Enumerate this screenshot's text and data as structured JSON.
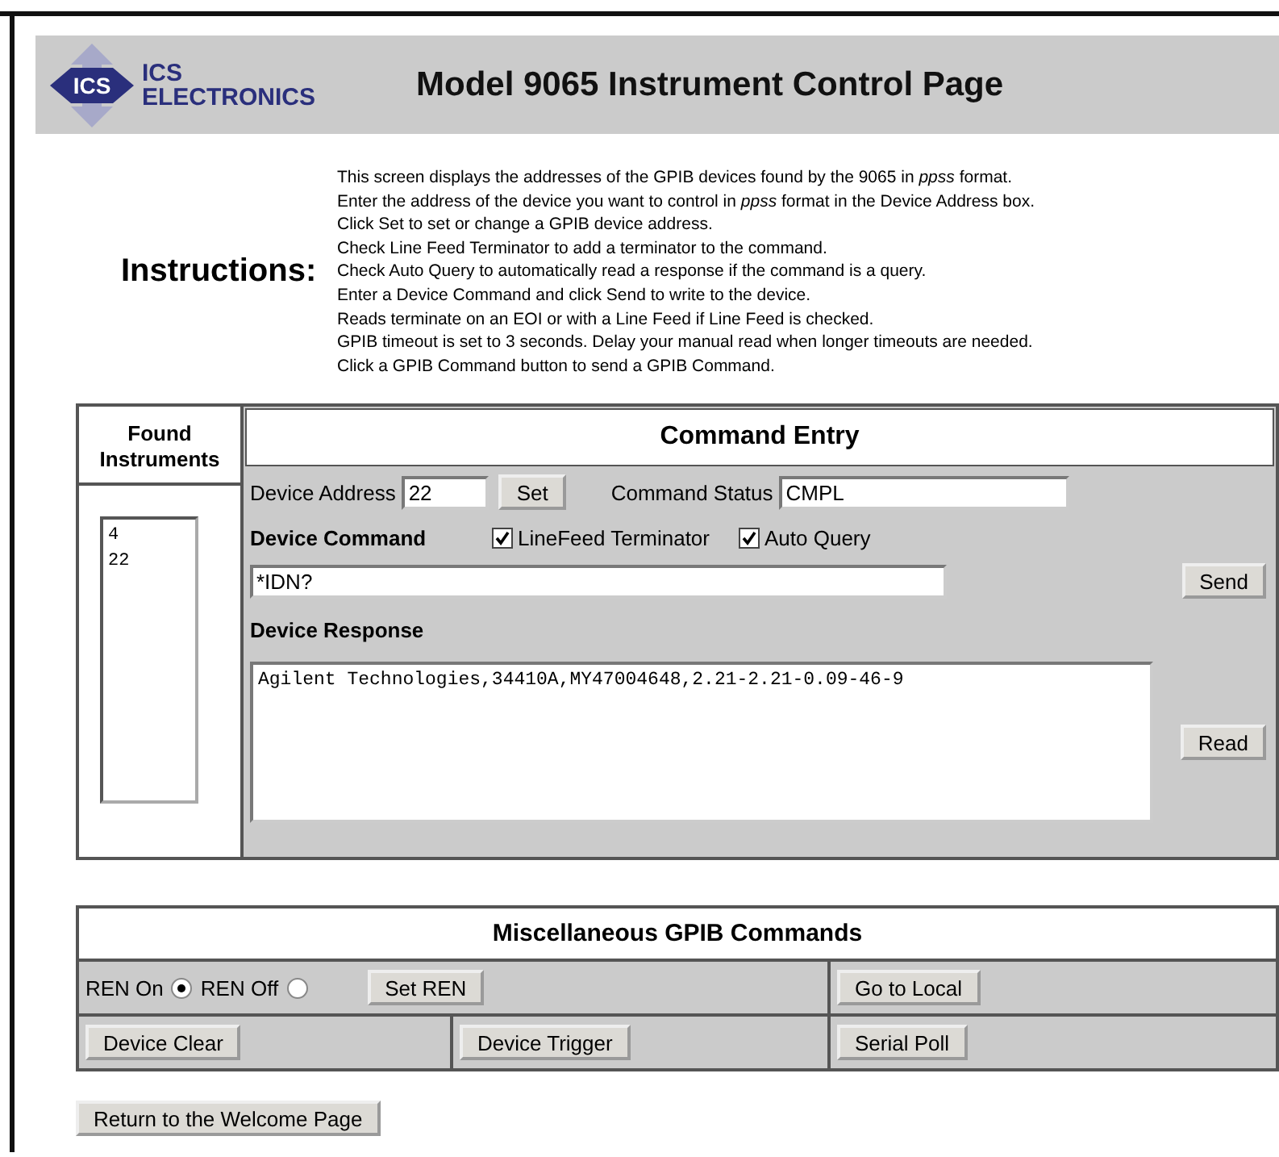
{
  "header": {
    "logo_badge": "ICS",
    "logo_line_1": "ICS",
    "logo_line_2": "ELECTRONICS",
    "title": "Model 9065 Instrument Control Page"
  },
  "instructions": {
    "heading": "Instructions:",
    "lines": [
      "This screen displays the addresses of the GPIB devices found by the 9065 in *ppss* format.",
      "Enter the address of the device you want to control in *ppss* format in the Device Address box.",
      "Click Set to set or change a GPIB device address.",
      "Check Line Feed Terminator to add a terminator to the command.",
      "Check Auto Query to automatically read a response if the command is a query.",
      "Enter a Device Command and click Send to write to the device.",
      "Reads terminate on an EOI or with a Line Feed if Line Feed is checked.",
      "GPIB timeout is set to 3 seconds. Delay your manual read when longer timeouts are needed.",
      "Click a GPIB Command button to send a GPIB Command."
    ]
  },
  "found_instruments": {
    "heading": "Found Instruments",
    "items": [
      "4",
      "22"
    ]
  },
  "command_entry": {
    "heading": "Command Entry",
    "device_address_label": "Device Address",
    "device_address": "22",
    "set_button": "Set",
    "command_status_label": "Command Status",
    "command_status": "CMPL",
    "device_command_label": "Device Command",
    "options": [
      {
        "label": "LineFeed Terminator",
        "checked": true
      },
      {
        "label": "Auto Query",
        "checked": true
      }
    ],
    "device_command": "*IDN?",
    "send_button": "Send",
    "device_response_label": "Device Response",
    "device_response": "Agilent Technologies,34410A,MY47004648,2.21-2.21-0.09-46-9",
    "read_button": "Read"
  },
  "misc_commands": {
    "heading": "Miscellaneous GPIB Commands",
    "ren_options": [
      {
        "label": "REN On",
        "selected": true
      },
      {
        "label": "REN Off",
        "selected": false
      }
    ],
    "set_ren_button": "Set REN",
    "go_to_local_button": "Go to Local",
    "device_clear_button": "Device Clear",
    "device_trigger_button": "Device Trigger",
    "serial_poll_button": "Serial Poll"
  },
  "return_button": "Return to the Welcome Page"
}
